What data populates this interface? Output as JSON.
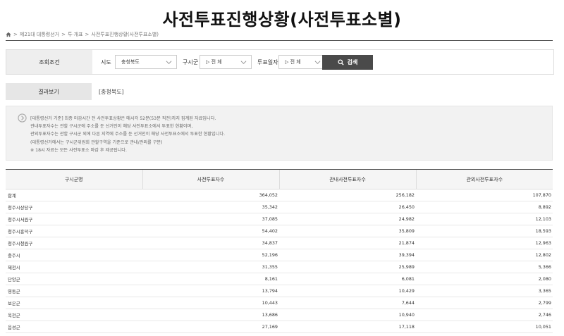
{
  "page": {
    "title": "사전투표진행상황(사전투표소별)",
    "breadcrumb": [
      "제21대 대통령선거",
      "투·개표",
      "사전투표진행상황(사전투표소별)"
    ]
  },
  "search": {
    "label": "조회조건",
    "sido_label": "시도",
    "sido_value": "충청북도",
    "gusigun_label": "구시군",
    "gusigun_value": "▷ 전 체",
    "date_label": "투표일자",
    "date_value": "▷ 전 체",
    "button_label": "검색"
  },
  "result": {
    "label": "결과보기",
    "value": "[충청북도]"
  },
  "notice": {
    "lines": [
      "[대통령선거 기준] 최종 마감시간 전 사전투표상황은 매시각 52분(53분 직전)까지 집계된 자료입니다.",
      "관내투표자수는 관할 구시군에 주소를 둔 선거인이 해당 사전투표소에서 투표한 현황이며,",
      "관외투표자수는 관할 구시군 외에 다른 지역에 주소를 둔 선거인이 해당 사전투표소에서 투표한 현황입니다.",
      "(대통령선거에서는 구시군위원회 관할구역을 기준으로 관내/관외를 구분)",
      "※ 18시 자료는 모든 사전투표소 마감 후 제공됩니다."
    ]
  },
  "table": {
    "headers": [
      "구시군명",
      "사전투표자수",
      "관내사전투표자수",
      "관외사전투표자수"
    ],
    "rows": [
      [
        "합계",
        "364,052",
        "256,182",
        "107,870"
      ],
      [
        "청주시상당구",
        "35,342",
        "26,450",
        "8,892"
      ],
      [
        "청주시서원구",
        "37,085",
        "24,982",
        "12,103"
      ],
      [
        "청주시흥덕구",
        "54,402",
        "35,809",
        "18,593"
      ],
      [
        "청주시청원구",
        "34,837",
        "21,874",
        "12,963"
      ],
      [
        "충주시",
        "52,196",
        "39,394",
        "12,802"
      ],
      [
        "제천시",
        "31,355",
        "25,989",
        "5,366"
      ],
      [
        "단양군",
        "8,161",
        "6,081",
        "2,080"
      ],
      [
        "영동군",
        "13,794",
        "10,429",
        "3,365"
      ],
      [
        "보은군",
        "10,443",
        "7,644",
        "2,799"
      ],
      [
        "옥천군",
        "13,686",
        "10,940",
        "2,746"
      ],
      [
        "음성군",
        "27,169",
        "17,118",
        "10,051"
      ]
    ]
  }
}
